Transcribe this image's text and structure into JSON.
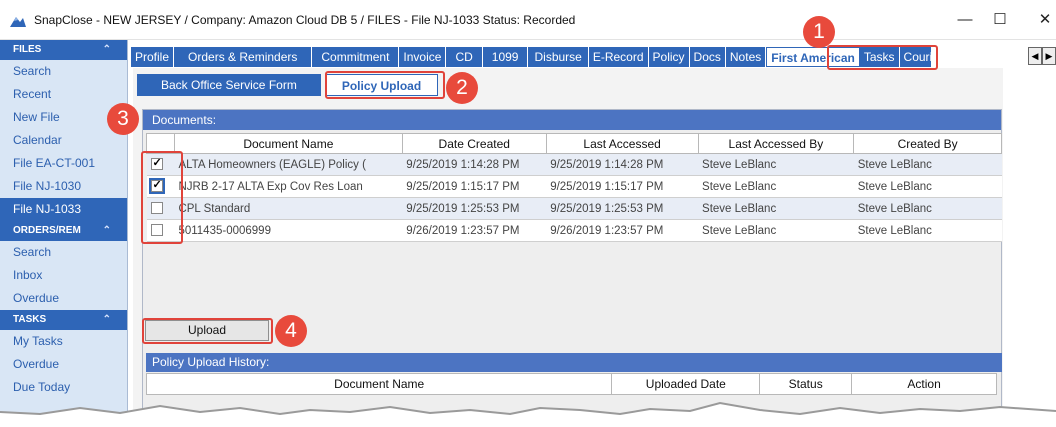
{
  "window": {
    "title": "SnapClose - NEW JERSEY / Company: Amazon Cloud DB 5 / FILES - File NJ-1033  Status: Recorded",
    "minimize": "—",
    "maximize": "☐",
    "close": "✕"
  },
  "sidebar": {
    "sections": [
      {
        "header": "FILES",
        "items": [
          "Search",
          "Recent",
          "New File",
          "Calendar",
          "File EA-CT-001",
          "File NJ-1030",
          "File NJ-1033"
        ]
      },
      {
        "header": "ORDERS/REM",
        "items": [
          "Search",
          "Inbox",
          "Overdue"
        ]
      },
      {
        "header": "TASKS",
        "items": [
          "My Tasks",
          "Overdue",
          "Due Today"
        ]
      }
    ],
    "active_item": "File NJ-1033",
    "chevron": "⌃"
  },
  "tabs": [
    "Profile",
    "Orders & Reminders",
    "Commitment",
    "Invoice",
    "CD",
    "1099",
    "Disburse",
    "E-Record",
    "Policy",
    "Docs",
    "Notes",
    "First American",
    "Tasks",
    "Courie"
  ],
  "active_tab": "First American",
  "tab_arrows": [
    "◀",
    "▶"
  ],
  "subtabs": [
    "Back Office Service Form",
    "Policy Upload"
  ],
  "active_subtab": "Policy Upload",
  "documents": {
    "header": "Documents:",
    "columns": [
      "",
      "Document Name",
      "Date Created",
      "Last Accessed",
      "Last Accessed By",
      "Created By"
    ],
    "rows": [
      {
        "checked": true,
        "name": "ALTA Homeowners (EAGLE) Policy (",
        "created": "9/25/2019 1:14:28 PM",
        "accessed": "9/25/2019 1:14:28 PM",
        "accessed_by": "Steve LeBlanc",
        "created_by": "Steve LeBlanc"
      },
      {
        "checked": true,
        "name": "NJRB 2-17 ALTA Exp Cov Res Loan",
        "created": "9/25/2019 1:15:17 PM",
        "accessed": "9/25/2019 1:15:17 PM",
        "accessed_by": "Steve LeBlanc",
        "created_by": "Steve LeBlanc"
      },
      {
        "checked": false,
        "name": "CPL Standard",
        "created": "9/25/2019 1:25:53 PM",
        "accessed": "9/25/2019 1:25:53 PM",
        "accessed_by": "Steve LeBlanc",
        "created_by": "Steve LeBlanc"
      },
      {
        "checked": false,
        "name": "5011435-0006999",
        "created": "9/26/2019 1:23:57 PM",
        "accessed": "9/26/2019 1:23:57 PM",
        "accessed_by": "Steve LeBlanc",
        "created_by": "Steve LeBlanc"
      }
    ]
  },
  "upload_button": "Upload",
  "history": {
    "header": "Policy Upload History:",
    "columns": [
      "Document Name",
      "Uploaded Date",
      "Status",
      "Action"
    ]
  },
  "callouts": [
    "1",
    "2",
    "3",
    "4"
  ],
  "colors": {
    "accent": "#2f66b8",
    "callout": "#e84a3c",
    "panel_header": "#4c74c2"
  }
}
